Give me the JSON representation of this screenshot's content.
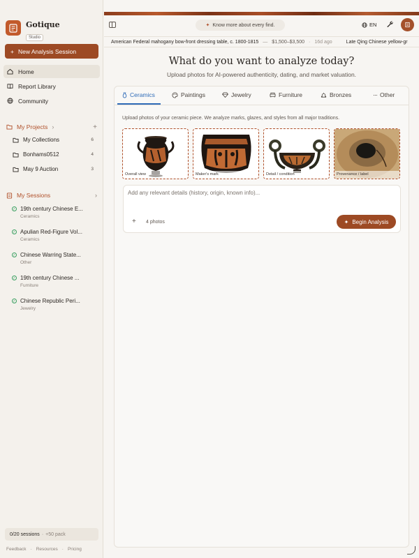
{
  "brand": {
    "name": "Gotique",
    "badge": "Studio"
  },
  "sidebar": {
    "new_session": "New Analysis Session",
    "nav": [
      {
        "label": "Home",
        "icon": "home-icon"
      },
      {
        "label": "Report Library",
        "icon": "book-icon"
      },
      {
        "label": "Community",
        "icon": "globe-icon"
      }
    ],
    "projects": {
      "title": "My Projects",
      "items": [
        {
          "label": "My Collections",
          "count": "6"
        },
        {
          "label": "Bonhams0512",
          "count": "4"
        },
        {
          "label": "May 9 Auction",
          "count": "3"
        }
      ]
    },
    "sessions": {
      "title": "My Sessions",
      "items": [
        {
          "title": "19th century Chinese E...",
          "category": "Ceramics"
        },
        {
          "title": "Apulian Red-Figure Vol...",
          "category": "Ceramics"
        },
        {
          "title": "Chinese Warring State...",
          "category": "Other"
        },
        {
          "title": "19th century Chinese ...",
          "category": "Furniture"
        },
        {
          "title": "Chinese Republic Peri...",
          "category": "Jewelry"
        }
      ]
    },
    "usage": {
      "count": "0/20 sessions",
      "pack": "+50 pack"
    },
    "footer": [
      "Feedback",
      "Resources",
      "Pricing"
    ]
  },
  "topbar": {
    "prompt": "Know more about every find.",
    "lang": "EN"
  },
  "ticker": [
    {
      "title": "American Federal mahogany bow-front dressing table, c. 1800-1815",
      "price": "$1,500–$3,500",
      "age": "16d ago"
    },
    {
      "title": "Late Qing Chinese yellow-gr"
    }
  ],
  "main": {
    "headline": "What do you want to analyze today?",
    "subline": "Upload photos for AI-powered authenticity, dating, and market valuation.",
    "tabs": [
      "Ceramics",
      "Paintings",
      "Jewelry",
      "Furniture",
      "Bronzes",
      "Other"
    ],
    "hint": "Upload photos of your ceramic piece. We analyze marks, glazes, and styles from all major traditions.",
    "photos": [
      "Overall view",
      "Maker's mark",
      "Detail / condition",
      "Provenance / label"
    ],
    "details_placeholder": "Add any relevant details (history, origin, known info)...",
    "photo_count": "4 photos",
    "begin": "Begin Analysis"
  },
  "colors": {
    "accent": "#9d4a24",
    "active_tab": "#2e6bb8",
    "success": "#3aa061"
  }
}
